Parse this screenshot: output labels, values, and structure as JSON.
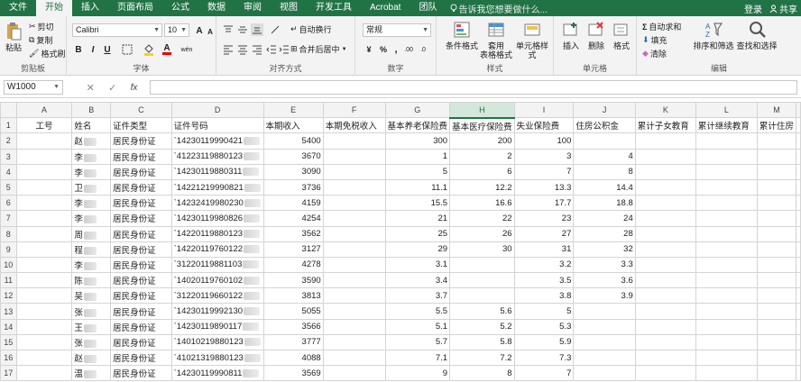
{
  "tabs": [
    "文件",
    "开始",
    "插入",
    "页面布局",
    "公式",
    "数据",
    "审阅",
    "视图",
    "开发工具",
    "Acrobat",
    "团队"
  ],
  "active_tab": "开始",
  "tellme": "告诉我您想要做什么...",
  "account": {
    "login": "登录",
    "share": "共享"
  },
  "ribbon": {
    "clipboard": {
      "paste": "粘贴",
      "cut": "剪切",
      "copy": "复制",
      "format_painter": "格式刷",
      "label": "剪贴板"
    },
    "font": {
      "name": "Calibri",
      "size": "10",
      "bold": "B",
      "italic": "I",
      "underline": "U",
      "grow": "A",
      "shrink": "A",
      "font_color": "A",
      "wen": "wén",
      "label": "字体"
    },
    "alignment": {
      "wrap": "自动换行",
      "merge": "合并后居中",
      "label": "对齐方式"
    },
    "number": {
      "format": "常规",
      "label": "数字"
    },
    "styles": {
      "conditional": "条件格式",
      "table": "套用\n表格格式",
      "cell_styles": "单元格样式",
      "label": "样式"
    },
    "cells": {
      "insert": "插入",
      "delete": "删除",
      "format": "格式",
      "label": "单元格"
    },
    "editing": {
      "autosum": "自动求和",
      "fill": "填充",
      "clear": "清除",
      "sort": "排序和筛选",
      "find": "查找和选择",
      "label": "编辑"
    }
  },
  "formula_bar": {
    "cell": "W1000",
    "fx": "fx",
    "value": ""
  },
  "columns": [
    "A",
    "B",
    "C",
    "D",
    "E",
    "F",
    "G",
    "H",
    "I",
    "J",
    "K",
    "L",
    "M"
  ],
  "highlight_column": "H",
  "header_row": [
    "工号",
    "姓名",
    "证件类型",
    "证件号码",
    "本期收入",
    "本期免税收入",
    "基本养老保险费",
    "基本医疗保险费",
    "失业保险费",
    "住房公积金",
    "累计子女教育",
    "累计继续教育",
    "累计住房"
  ],
  "rows": [
    {
      "n": "2",
      "name": "赵",
      "type": "居民身份证",
      "id": "`14230119990421",
      "income": "5400",
      "g": "300",
      "h": "200",
      "i": "100",
      "j": ""
    },
    {
      "n": "3",
      "name": "李",
      "type": "居民身份证",
      "id": "`41223119880123",
      "income": "3670",
      "g": "1",
      "h": "2",
      "i": "3",
      "j": "4"
    },
    {
      "n": "4",
      "name": "李",
      "type": "居民身份证",
      "id": "`14230119880311",
      "income": "3090",
      "g": "5",
      "h": "6",
      "i": "7",
      "j": "8"
    },
    {
      "n": "5",
      "name": "卫",
      "type": "居民身份证",
      "id": "`14221219990821",
      "income": "3736",
      "g": "11.1",
      "h": "12.2",
      "i": "13.3",
      "j": "14.4"
    },
    {
      "n": "6",
      "name": "李",
      "type": "居民身份证",
      "id": "`14232419980230",
      "income": "4159",
      "g": "15.5",
      "h": "16.6",
      "i": "17.7",
      "j": "18.8"
    },
    {
      "n": "7",
      "name": "李",
      "type": "居民身份证",
      "id": "`14230119980826",
      "income": "4254",
      "g": "21",
      "h": "22",
      "i": "23",
      "j": "24"
    },
    {
      "n": "8",
      "name": "周",
      "type": "居民身份证",
      "id": "`14220119880123",
      "income": "3562",
      "g": "25",
      "h": "26",
      "i": "27",
      "j": "28"
    },
    {
      "n": "9",
      "name": "程",
      "type": "居民身份证",
      "id": "`14220119760122",
      "income": "3127",
      "g": "29",
      "h": "30",
      "i": "31",
      "j": "32"
    },
    {
      "n": "10",
      "name": "李",
      "type": "居民身份证",
      "id": "`31220119881103",
      "income": "4278",
      "g": "3.1",
      "h": "",
      "i": "3.2",
      "j": "3.3"
    },
    {
      "n": "11",
      "name": "陈",
      "type": "居民身份证",
      "id": "`14020119760102",
      "income": "3590",
      "g": "3.4",
      "h": "",
      "i": "3.5",
      "j": "3.6"
    },
    {
      "n": "12",
      "name": "吴",
      "type": "居民身份证",
      "id": "`31220119660122",
      "income": "3813",
      "g": "3.7",
      "h": "",
      "i": "3.8",
      "j": "3.9"
    },
    {
      "n": "13",
      "name": "张",
      "type": "居民身份证",
      "id": "`14230119992130",
      "income": "5055",
      "g": "5.5",
      "h": "5.6",
      "i": "5",
      "j": ""
    },
    {
      "n": "14",
      "name": "王",
      "type": "居民身份证",
      "id": "`14230119890117",
      "income": "3566",
      "g": "5.1",
      "h": "5.2",
      "i": "5.3",
      "j": ""
    },
    {
      "n": "15",
      "name": "张",
      "type": "居民身份证",
      "id": "`14010219880123",
      "income": "3777",
      "g": "5.7",
      "h": "5.8",
      "i": "5.9",
      "j": ""
    },
    {
      "n": "16",
      "name": "赵",
      "type": "居民身份证",
      "id": "`41021319880123",
      "income": "4088",
      "g": "7.1",
      "h": "7.2",
      "i": "7.3",
      "j": ""
    },
    {
      "n": "17",
      "name": "温",
      "type": "居民身份证",
      "id": "`14230119990811",
      "income": "3569",
      "g": "9",
      "h": "8",
      "i": "7",
      "j": ""
    }
  ],
  "colors": {
    "accent": "#217346",
    "ribbon_bg": "#f3f3f3",
    "grid_line": "#d4d4d4"
  }
}
